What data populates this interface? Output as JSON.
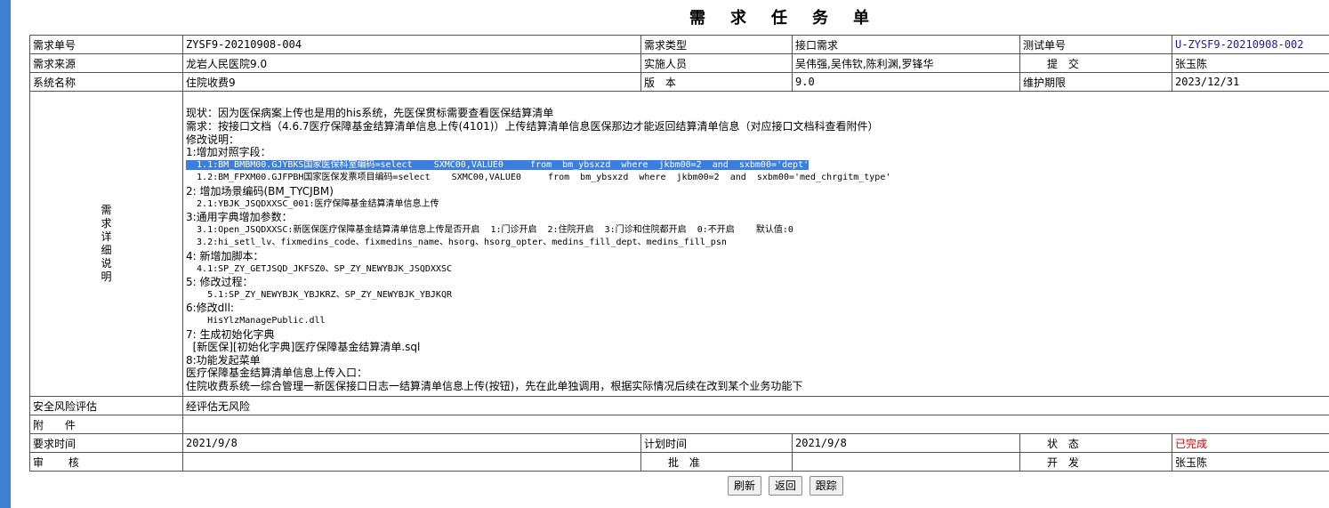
{
  "page_title": "需求任务单",
  "row1": {
    "l1": "需求单号",
    "v1": "ZYSF9-20210908-004",
    "l2": "需求类型",
    "v2": "接口需求",
    "l3": "测试单号",
    "v3": "U-ZYSF9-20210908-002"
  },
  "row2": {
    "l1": "需求来源",
    "v1": "龙岩人民医院9.0",
    "l2": "实施人员",
    "v2": "吴伟强,吴伟钦,陈利渊,罗锋华",
    "l3": "提 交",
    "v3": "张玉陈"
  },
  "row3": {
    "l1": "系统名称",
    "v1": "住院收费9",
    "l2": "版 本",
    "v2": "9.0",
    "l3": "维护期限",
    "v3": "2023/12/31"
  },
  "detail_label": [
    "需",
    "求",
    "详",
    "细",
    "说",
    "明"
  ],
  "detail_lines": [
    "现状：因为医保病案上传也是用的his系统，先医保贯标需要查看医保结算清单",
    "需求：按接口文档（4.6.7医疗保障基金结算清单信息上传(4101)）上传结算清单信息医保那边才能返回结算清单信息（对应接口文档科查看附件）",
    "修改说明：",
    "1:增加对照字段：",
    "  1.1:BM_BMBM00.GJYBKS国家医保科室编码=select    SXMC00,VALUE0     from  bm_ybsxzd  where  jkbm00=2  and  sxbm00='dept'",
    "  1.2:BM_FPXM00.GJFPBH国家医保发票项目编码=select    SXMC00,VALUE0     from  bm_ybsxzd  where  jkbm00=2  and  sxbm00='med_chrgitm_type'",
    "2: 增加场景编码(BM_TYCJBM)",
    "  2.1:YBJK_JSQDXXSC_001:医疗保障基金结算清单信息上传",
    "3:通用字典增加参数：",
    "  3.1:Open_JSQDXXSC:新医保医疗保障基金结算清单信息上传是否开启  1:门诊开启  2:住院开启  3:门诊和住院都开启  0:不开启    默认值:0",
    "  3.2:hi_setl_lv、fixmedins_code、fixmedins_name、hsorg、hsorg_opter、medins_fill_dept、medins_fill_psn",
    "4: 新增加脚本：",
    "  4.1:SP_ZY_GETJSQD_JKFSZ0、SP_ZY_NEWYBJK_JSQDXXSC",
    "5: 修改过程：",
    "    5.1:SP_ZY_NEWYBJK_YBJKRZ、SP_ZY_NEWYBJK_YBJKQR",
    "6:修改dll:",
    "    HisYlzManagePublic.dll",
    "7: 生成初始化字典",
    "  [新医保][初始化字典]医疗保障基金结算清单.sql",
    "8:功能发起菜单",
    "医疗保障基金结算清单信息上传入口：",
    "住院收费系统一综合管理一新医保接口日志一结算清单信息上传(按钮)，先在此单独调用，根据实际情况后续在改到某个业务功能下"
  ],
  "risk": {
    "label": "安全风险评估",
    "value": "经评估无风险"
  },
  "attachment": {
    "label": "附 件",
    "value": ""
  },
  "row_time": {
    "l1": "要求时间",
    "v1": "2021/9/8",
    "l2": "计划时间",
    "v2": "2021/9/8",
    "l3": "状 态",
    "v3": "已完成"
  },
  "row_review": {
    "l1": "审 核",
    "v1": "",
    "l2": "批 准",
    "v2": "",
    "l3": "开 发",
    "v3": "张玉陈"
  },
  "buttons": {
    "refresh": "刷新",
    "back": "返回",
    "track": "跟踪"
  },
  "colors": {
    "status_done": "#e00000",
    "link": "#1a1aa8",
    "left_bar": "#3d7fd0",
    "highlight": "#3a7ee0"
  }
}
